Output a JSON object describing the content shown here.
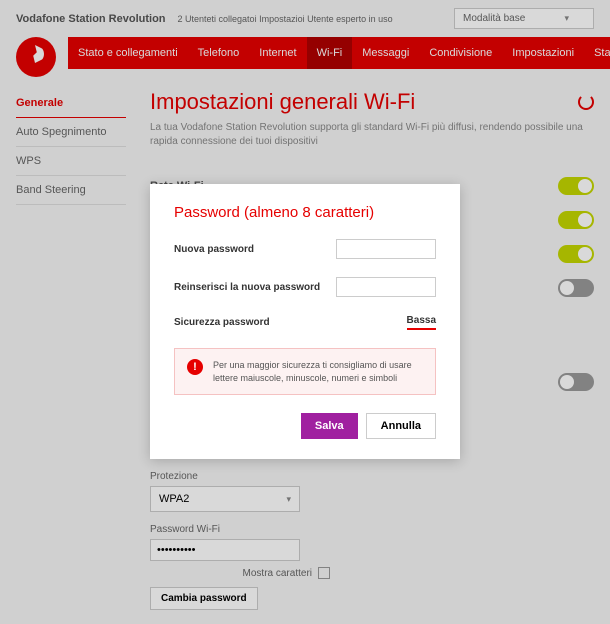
{
  "topbar": {
    "title": "Vodafone Station Revolution",
    "status": "2 Utenteti collegatoi Impostazioi Utente esperto in uso",
    "mode": "Modalità base"
  },
  "nav": {
    "items": [
      "Stato e collegamenti",
      "Telefono",
      "Internet",
      "Wi-Fi",
      "Messaggi",
      "Condivisione",
      "Impostazioni",
      "Stato & Supporto"
    ],
    "active_index": 3
  },
  "sidebar": {
    "items": [
      "Generale",
      "Auto Spegnimento",
      "WPS",
      "Band Steering"
    ],
    "active_index": 0
  },
  "page": {
    "title": "Impostazioni generali Wi-Fi",
    "desc": "La tua Vodafone Station Revolution supporta gli standard Wi-Fi più diffusi, rendendo possibile una rapida connessione dei tuoi dispositivi"
  },
  "settings": {
    "wifi_label": "Rete Wi-Fi",
    "toggles": [
      "on",
      "on",
      "on",
      "off",
      "off"
    ],
    "protection_label": "Protezione",
    "protection_value": "WPA2",
    "password_label": "Password Wi-Fi",
    "password_value": "••••••••••",
    "show_chars": "Mostra caratteri",
    "change_pw": "Cambia password"
  },
  "modal": {
    "title": "Password (almeno 8 caratteri)",
    "new_pw": "Nuova password",
    "confirm_pw": "Reinserisci la nuova password",
    "strength_label": "Sicurezza password",
    "strength_value": "Bassa",
    "warning": "Per una maggior sicurezza ti consigliamo di usare lettere maiuscole, minuscole, numeri e simboli",
    "save": "Salva",
    "cancel": "Annulla"
  }
}
